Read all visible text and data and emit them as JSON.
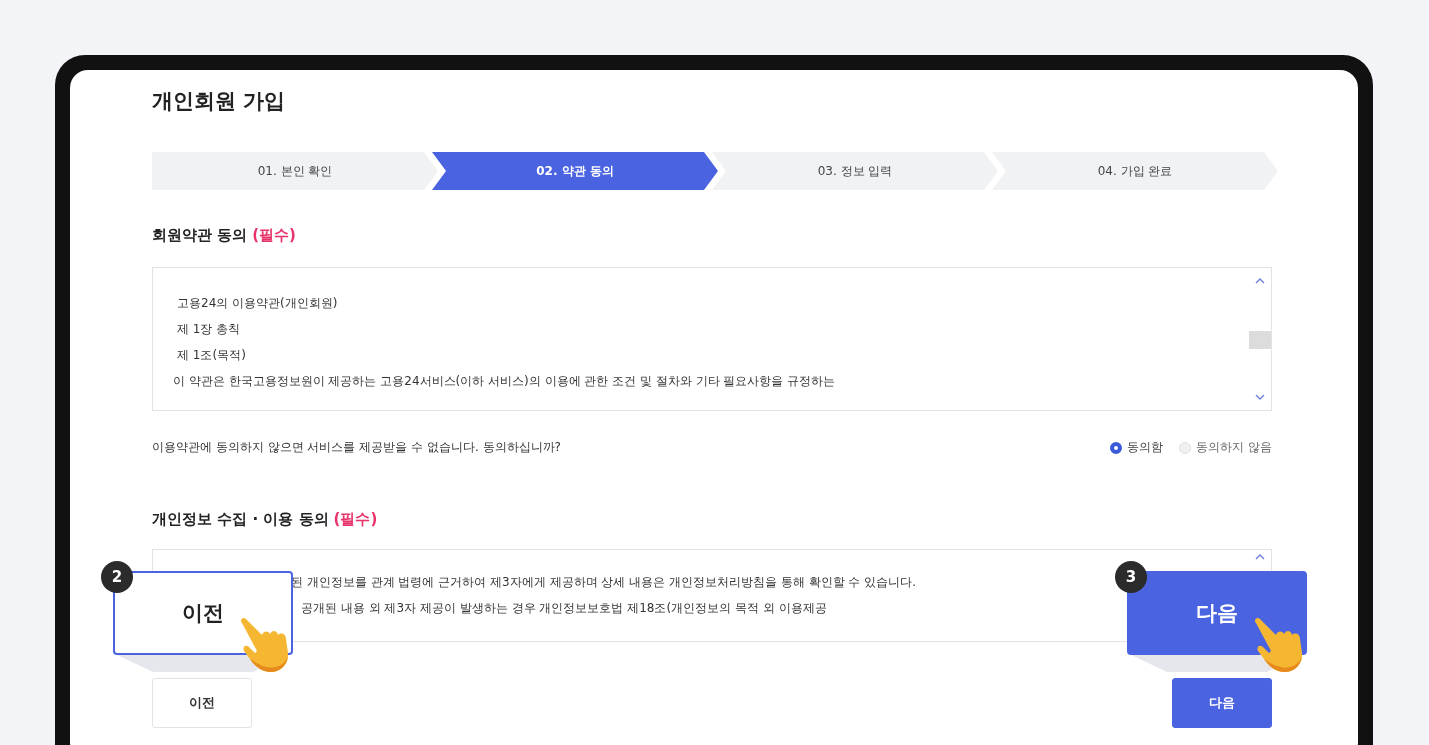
{
  "page_title": "개인회원 가입",
  "steps": [
    {
      "label": "01. 본인 확인",
      "selected": false
    },
    {
      "label": "02. 약관 동의",
      "selected": true
    },
    {
      "label": "03. 정보 입력",
      "selected": false
    },
    {
      "label": "04. 가입 완료",
      "selected": false
    }
  ],
  "terms": {
    "title": "회원약관 동의",
    "required_mark": "(필수)",
    "lines": [
      "고용24의 이용약관(개인회원)",
      "제 1장 총칙",
      "제 1조(목적)",
      "이 약관은 한국고용정보원이 제공하는 고용24서비스(이하 서비스)의 이용에 관한 조건 및 절차와 기타 필요사항을 규정하는"
    ],
    "question": "이용약관에 동의하지 않으면 서비스를 제공받을 수 없습니다.  동의하십니까?",
    "options": [
      {
        "label": "동의함",
        "selected": true,
        "disabled": false
      },
      {
        "label": "동의하지 않음",
        "selected": false,
        "disabled": true
      }
    ]
  },
  "privacy": {
    "title": "개인정보 수집 · 이용 동의",
    "required_mark": "(필수)",
    "lines": [
      "된 개인정보를 관계 법령에 근거하여 제3자에게 제공하며 상세 내용은 개인정보처리방침을 통해 확인할 수 있습니다.",
      "공개된 내용 외 제3자 제공이 발생하는 경우 개인정보보호법 제18조(개인정보의 목적 외 이용제공"
    ]
  },
  "buttons": [
    {
      "label": "이전",
      "kind": "secondary"
    },
    {
      "label": "다음",
      "kind": "primary"
    }
  ],
  "callouts": [
    {
      "number": "2",
      "label": "이전",
      "kind": "secondary"
    },
    {
      "number": "3",
      "label": "다음",
      "kind": "primary"
    }
  ]
}
